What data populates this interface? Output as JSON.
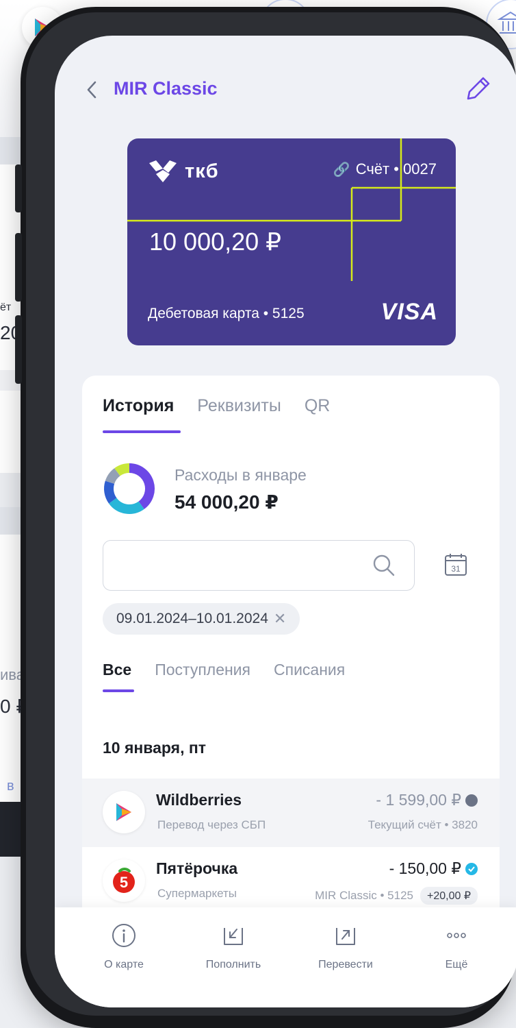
{
  "header": {
    "title": "MIR Classic",
    "back_icon": "chevron-left-icon",
    "edit_icon": "pencil-icon"
  },
  "card": {
    "bank_name": "ткб",
    "account_label": "Счёт • 0027",
    "balance": "10 000,20 ₽",
    "card_type": "Дебетовая карта • 5125",
    "network": "VISA",
    "colors": {
      "background": "#463c8f",
      "accent_lines": "#d6ea1a"
    }
  },
  "tabs": [
    "История",
    "Реквизиты",
    "QR"
  ],
  "expenses": {
    "label": "Расходы в январе",
    "amount": "54 000,20 ₽"
  },
  "search": {
    "placeholder": ""
  },
  "date_filter": "09.01.2024–10.01.2024",
  "filter_tabs": [
    "Все",
    "Поступления",
    "Списания"
  ],
  "date_group": "10 января, пт",
  "transactions": [
    {
      "name": "Wildberries",
      "category": "Перевод через СБП",
      "amount": "- 1 599,00 ₽",
      "account": "Текущий счёт • 3820",
      "status_color": "#6b7386"
    },
    {
      "name": "Пятёрочка",
      "category": "Супермаркеты",
      "amount": "- 150,00 ₽",
      "account": "MIR Classic • 5125",
      "bonus": "+20,00 ₽",
      "status_color": "#25b8e6"
    }
  ],
  "bottom_nav": [
    {
      "label": "О карте",
      "icon": "info-icon"
    },
    {
      "label": "Пополнить",
      "icon": "top-up-icon"
    },
    {
      "label": "Перевести",
      "icon": "transfer-icon"
    },
    {
      "label": "Ещё",
      "icon": "more-icon"
    }
  ],
  "background_app": {
    "snippets": [
      "ёт",
      "20",
      "ива",
      "0 ₽",
      "в"
    ]
  },
  "chart_data": {
    "type": "pie",
    "values": [
      40,
      25,
      15,
      10,
      10
    ],
    "colors": [
      "#6c47e6",
      "#27b6d8",
      "#2f5fd0",
      "#93a0b5",
      "#c9e83a"
    ]
  }
}
